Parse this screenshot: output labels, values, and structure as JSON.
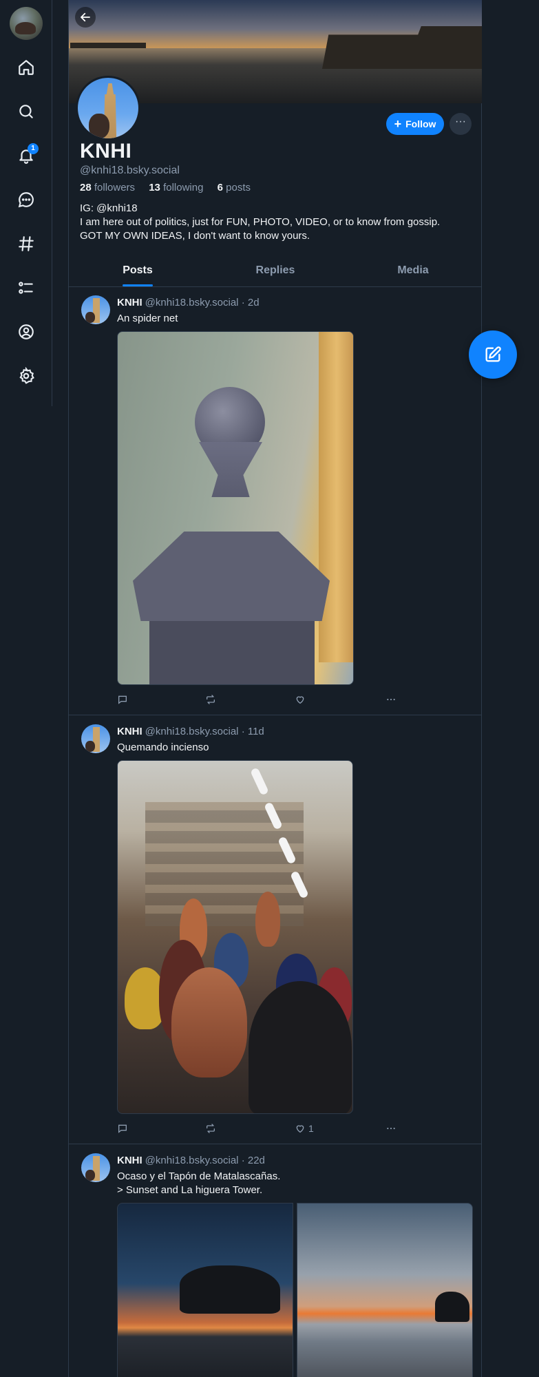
{
  "nav": {
    "notifications_count": "1",
    "items": [
      "home-icon",
      "search-icon",
      "bell-icon",
      "chat-icon",
      "hashtag-icon",
      "list-icon",
      "profile-icon",
      "gear-icon"
    ]
  },
  "profile": {
    "display_name": "KNHI",
    "handle": "@knhi18.bsky.social",
    "followers_count": "28",
    "followers_label": "followers",
    "following_count": "13",
    "following_label": "following",
    "posts_count": "6",
    "posts_label": "posts",
    "bio_lines": [
      "IG: @knhi18",
      "I am here out of politics, just for FUN, PHOTO, VIDEO, or to know from gossip.",
      "GOT MY OWN IDEAS, I don't want to know yours."
    ],
    "follow_label": "Follow",
    "more_label": "···"
  },
  "tabs": [
    {
      "label": "Posts",
      "active": true
    },
    {
      "label": "Replies",
      "active": false
    },
    {
      "label": "Media",
      "active": false
    }
  ],
  "posts": [
    {
      "author": "KNHI",
      "handle": "@knhi18.bsky.social",
      "age": "· 2d",
      "text": "An spider net",
      "likes": ""
    },
    {
      "author": "KNHI",
      "handle": "@knhi18.bsky.social",
      "age": "· 11d",
      "text": "Quemando incienso",
      "likes": "1"
    },
    {
      "author": "KNHI",
      "handle": "@knhi18.bsky.social",
      "age": "· 22d",
      "text_lines": [
        "Ocaso y el Tapón de Matalascañas.",
        "> Sunset and La higuera Tower."
      ],
      "likes": ""
    }
  ],
  "colors": {
    "background": "#161e27",
    "accent": "#1083fe",
    "muted_text": "#8d9caf",
    "border": "#2e3b4b"
  }
}
